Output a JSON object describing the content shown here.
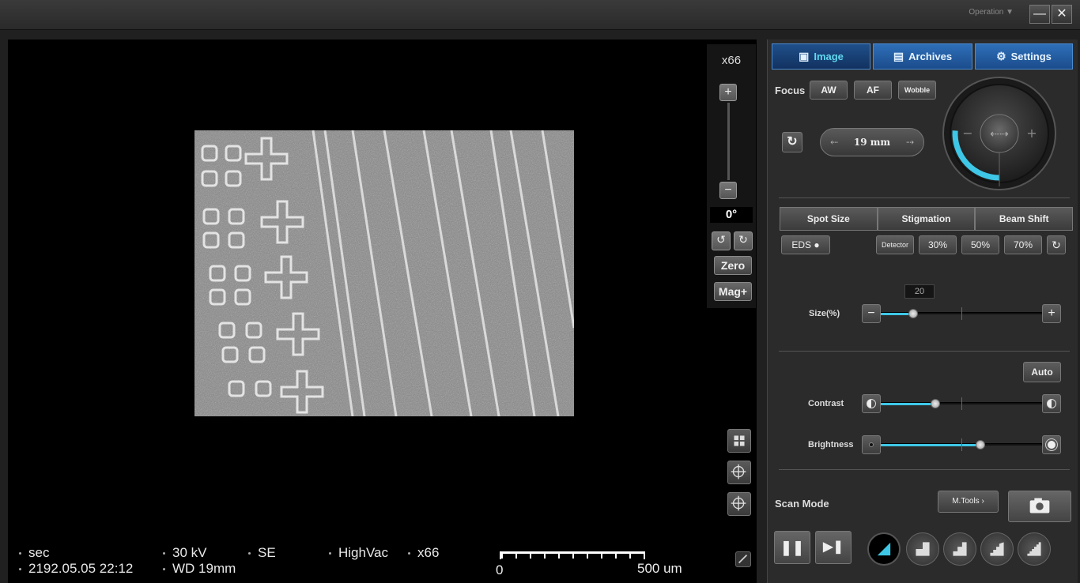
{
  "titlebar": {
    "mode": "Operation ▼",
    "minimize": "—",
    "close": "✕"
  },
  "mag_panel": {
    "magnification": "x66",
    "plus": "+",
    "minus": "−",
    "rotation": "0°",
    "rotate_ccw": "↺",
    "rotate_cw": "↻",
    "zero": "Zero",
    "mag_plus": "Mag+"
  },
  "status": {
    "scan_speed": "sec",
    "datetime": "2192.05.05 22:12",
    "voltage": "30 kV",
    "working_distance": "WD 19mm",
    "detector": "SE",
    "vacuum": "HighVac",
    "magnification": "x66",
    "scale_start": "0",
    "scale_end": "500 um"
  },
  "tabs": [
    {
      "label": "Image",
      "icon": "image-icon",
      "active": true
    },
    {
      "label": "Archives",
      "icon": "archive-icon",
      "active": false
    },
    {
      "label": "Settings",
      "icon": "gear-icon",
      "active": false
    }
  ],
  "focus": {
    "label": "Focus",
    "aw": "AW",
    "af": "AF",
    "wobble": "Wobble",
    "reset": "↻",
    "wd_value": "19 mm",
    "left_arrow": "⇠",
    "right_arrow": "⇢",
    "knob_minus": "−",
    "knob_plus": "+",
    "knob_level": 0.42,
    "accent_color": "#3ec7e6"
  },
  "beam": {
    "segments": [
      "Spot Size",
      "Stigmation",
      "Beam Shift"
    ],
    "eds": "EDS",
    "detector": "Detector",
    "presets": [
      "30%",
      "50%",
      "70%"
    ],
    "reset": "↻",
    "size_label": "Size(%)",
    "size_value": "20",
    "size_fraction": 0.2,
    "minus": "−",
    "plus": "+"
  },
  "image_adjust": {
    "auto": "Auto",
    "contrast_label": "Contrast",
    "contrast_fraction": 0.34,
    "brightness_label": "Brightness",
    "brightness_fraction": 0.62
  },
  "scan": {
    "label": "Scan Mode",
    "mtools": "M.Tools  ›",
    "pause": "❚❚",
    "step": "▶❚",
    "active_speed": 1
  }
}
